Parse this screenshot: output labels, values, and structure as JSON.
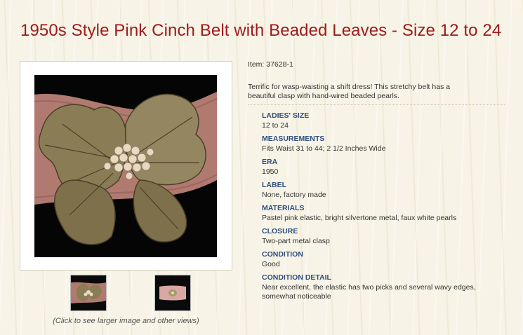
{
  "product": {
    "title": "1950s Style Pink Cinch Belt with Beaded Leaves - Size 12 to 24",
    "item_number": "Item: 37628-1",
    "description": "Terrific for wasp-waisting a shift dress! This stretchy belt has a beautiful clasp with hand-wired beaded pearls."
  },
  "gallery": {
    "caption": "(Click to see larger image and other views)"
  },
  "specs": [
    {
      "label": "LADIES' SIZE",
      "value": "12 to 24"
    },
    {
      "label": "MEASUREMENTS",
      "value": "Fits Waist 31 to 44; 2 1/2 Inches Wide"
    },
    {
      "label": "ERA",
      "value": "1950"
    },
    {
      "label": "LABEL",
      "value": "None, factory made"
    },
    {
      "label": "MATERIALS",
      "value": "Pastel pink elastic, bright silvertone metal, faux white pearls"
    },
    {
      "label": "CLOSURE",
      "value": "Two-part metal clasp"
    },
    {
      "label": "CONDITION",
      "value": "Good"
    },
    {
      "label": "CONDITION DETAIL",
      "value": "Near excellent, the elastic has two picks and several wavy edges, somewhat noticeable"
    }
  ],
  "colors": {
    "title": "#9b1b1b",
    "spec_label": "#2f4f7f",
    "belt_pink": "#b07a70",
    "metal": "#a89a6a"
  }
}
